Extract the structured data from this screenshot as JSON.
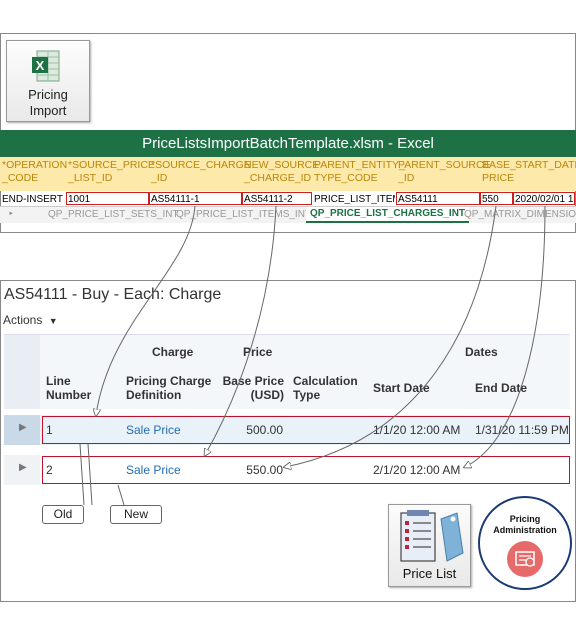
{
  "tile": {
    "line1": "Pricing",
    "line2": "Import",
    "icon": "excel-icon"
  },
  "excel": {
    "title": "PriceListsImportBatchTemplate.xlsm - Excel",
    "headers": [
      {
        "l1": "*OPERATION",
        "l2": "_CODE"
      },
      {
        "l1": "*SOURCE_PRICE",
        "l2": "_LIST_ID"
      },
      {
        "l1": "*SOURCE_CHARGE",
        "l2": "_ID"
      },
      {
        "l1": "NEW_SOURCE",
        "l2": "_CHARGE_ID"
      },
      {
        "l1": "PARENT_ENTITY_",
        "l2": "TYPE_CODE"
      },
      {
        "l1": "PARENT_SOURCE",
        "l2": "_ID"
      },
      {
        "l1": "BASE_",
        "l2": "PRICE"
      },
      {
        "l1": "",
        "l2": "START_DATE"
      }
    ],
    "row": [
      "END-INSERT",
      "1001",
      "AS54111-1",
      "AS54111-2",
      "PRICE_LIST_ITEM",
      "AS54111",
      "550",
      "2020/02/01 1"
    ],
    "tabs": [
      "QP_PRICE_LIST_SETS_INT",
      "QP_PRICE_LIST_ITEMS_INT",
      "QP_PRICE_LIST_CHARGES_INT",
      "QP_MATRIX_DIMENSION"
    ],
    "active_tab": 2
  },
  "charge": {
    "title": "AS54111 - Buy - Each: Charge",
    "actions": "Actions",
    "group_headers": {
      "charge": "Charge",
      "price": "Price",
      "dates": "Dates"
    },
    "columns": {
      "line_number": [
        "Line",
        "Number"
      ],
      "definition": [
        "Pricing Charge",
        "Definition"
      ],
      "base_price": [
        "Base Price",
        "(USD)"
      ],
      "calc_type": [
        "Calculation",
        "Type"
      ],
      "start_date": "Start Date",
      "end_date": "End Date"
    },
    "rows": [
      {
        "line": "1",
        "definition": "Sale Price",
        "price": "500.00",
        "calc": "",
        "start": "1/1/20 12:00 AM",
        "end": "1/31/20 11:59 PM"
      },
      {
        "line": "2",
        "definition": "Sale Price",
        "price": "550.00",
        "calc": "",
        "start": "2/1/20 12:00 AM",
        "end": ""
      }
    ]
  },
  "callouts": {
    "old": "Old",
    "new": "New"
  },
  "pricelist_tile": {
    "label": "Price List",
    "icon": "price-list-icon"
  },
  "pricing_admin": {
    "line1": "Pricing",
    "line2": "Administration",
    "icon": "pricing-admin-icon"
  },
  "colors": {
    "excel_green": "#1e7145",
    "header_yellow": "#fde9a9",
    "link_blue": "#236cb5",
    "highlight_red": "#c0102a",
    "admin_navy": "#1a3a74"
  }
}
